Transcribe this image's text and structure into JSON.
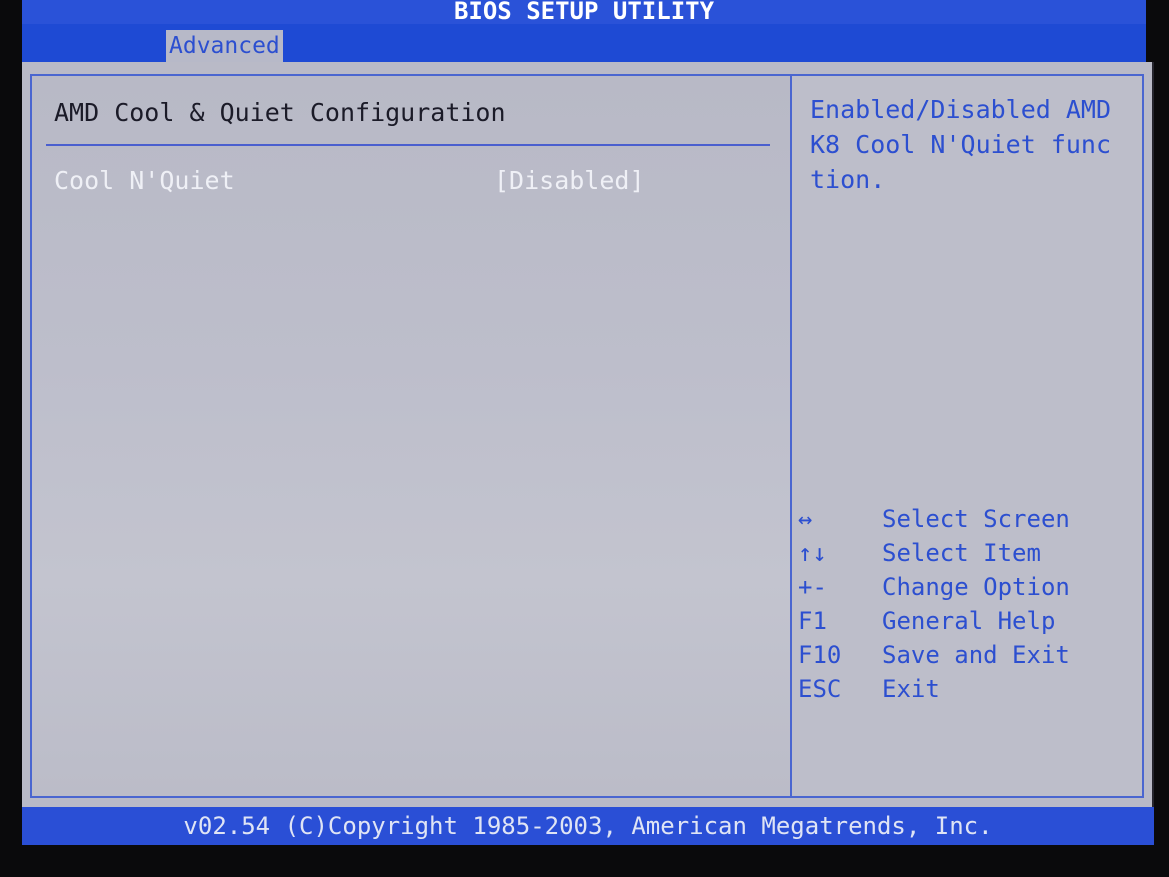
{
  "window": {
    "title": "BIOS SETUP UTILITY"
  },
  "menu": {
    "active_tab": "Advanced"
  },
  "main": {
    "section_title": "AMD Cool & Quiet Configuration",
    "option": {
      "label": "Cool N'Quiet",
      "value": "[Disabled]"
    }
  },
  "help": {
    "text": "Enabled/Disabled AMD\nK8 Cool N'Quiet func\ntion.",
    "keys": [
      {
        "key": "↔",
        "desc": "Select Screen"
      },
      {
        "key": "↑↓",
        "desc": "Select Item"
      },
      {
        "key": "+-",
        "desc": "Change Option"
      },
      {
        "key": "F1",
        "desc": "General Help"
      },
      {
        "key": "F10",
        "desc": "Save and Exit"
      },
      {
        "key": "ESC",
        "desc": "Exit"
      }
    ]
  },
  "footer": {
    "copyright": "v02.54 (C)Copyright 1985-2003, American Megatrends, Inc."
  },
  "colors": {
    "title_bar": "#2a52d8",
    "menu_bar": "#1e4ad4",
    "panel_bg": "#b9bac7",
    "accent_text": "#2c4fd0",
    "highlight_text": "#eff0f6",
    "footer_bar": "#2a4fd6"
  }
}
